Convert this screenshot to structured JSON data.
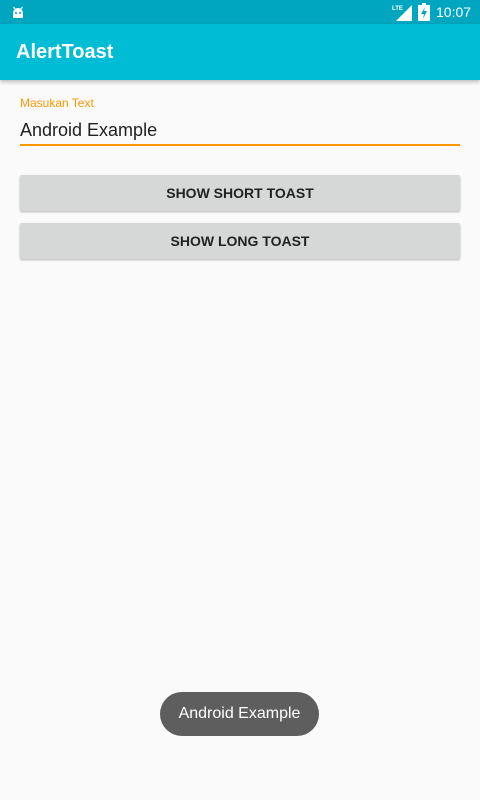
{
  "status_bar": {
    "time": "10:07",
    "network": "LTE",
    "icons": [
      "android-notification-icon",
      "lte-signal-icon",
      "battery-charging-icon"
    ]
  },
  "app_bar": {
    "title": "AlertToast"
  },
  "form": {
    "input_label": "Masukan Text",
    "input_value": "Android Example",
    "accent_color": "#ff9800"
  },
  "buttons": {
    "short_label": "SHOW SHORT TOAST",
    "long_label": "SHOW LONG TOAST"
  },
  "toast": {
    "message": "Android Example"
  },
  "colors": {
    "status_bar": "#00a6bf",
    "app_bar": "#00bcd4",
    "button": "#d6d7d7",
    "toast": "#5e5e5e"
  }
}
